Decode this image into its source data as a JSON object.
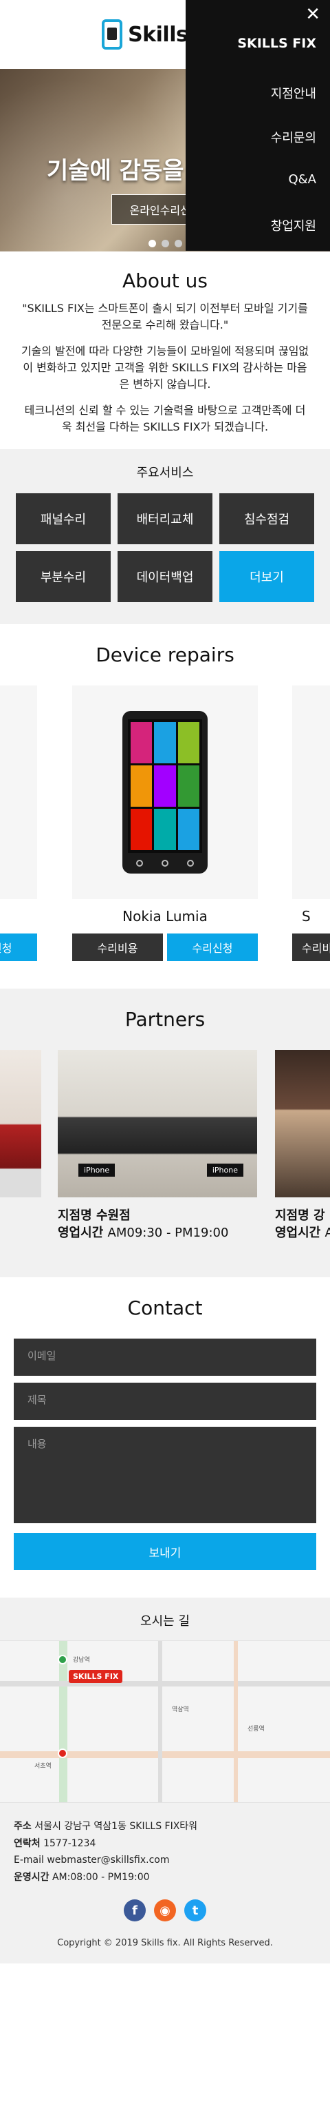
{
  "header": {
    "logo_text": "Skills Fix"
  },
  "hero": {
    "title": "기술에 감동을 더합니다.",
    "button_label": "온라인수리신청",
    "slide_count": 3,
    "active_slide": 1
  },
  "menu": {
    "close_label": "✕",
    "brand": "SKILLS FIX",
    "items": [
      "지점안내",
      "수리문의",
      "Q&A",
      "창업지원"
    ]
  },
  "about": {
    "title": "About us",
    "p1": "\"SKILLS FIX는 스마트폰이 출시 되기 이전부터 모바일 기기를 전문으로 수리해 왔습니다.\"",
    "p2": "기술의 발전에 따라 다양한 기능들이 모바일에 적용되며 끊임없이 변화하고 있지만 고객을 위한 SKILLS FIX의 감사하는 마음은 변하지 않습니다.",
    "p3": "테크니션의 신뢰 할 수 있는 기술력을 바탕으로 고객만족에 더욱 최선을 다하는 SKILLS FIX가 되겠습니다."
  },
  "services": {
    "title": "주요서비스",
    "items": [
      "패널수리",
      "배터리교체",
      "침수점검",
      "부분수리",
      "데이터백업",
      "더보기"
    ]
  },
  "devices": {
    "title": "Device repairs",
    "center_name": "Nokia Lumia",
    "cost_label": "수리비용",
    "request_label": "수리신청",
    "side_name_fragment": "S"
  },
  "partners": {
    "title": "Partners",
    "branch_label": "지점명",
    "hours_label": "영업시간",
    "center": {
      "name": "수원점",
      "hours": "AM09:30 - PM19:00"
    },
    "right": {
      "name": "강",
      "hours": "A"
    },
    "sign_text": "iPhone"
  },
  "contact": {
    "title": "Contact",
    "email_placeholder": "이메일",
    "subject_placeholder": "제목",
    "message_placeholder": "내용",
    "send_label": "보내기"
  },
  "footer": {
    "map_title": "오시는 길",
    "map_pin": "SKILLS FIX",
    "map_labels": [
      "강남역",
      "역삼역",
      "서초역",
      "선릉역"
    ],
    "address_label": "주소",
    "address": "서울시 강남구 역삼1동 SKILLS FIX타워",
    "phone_label": "연락처",
    "phone": "1577-1234",
    "email_label": "E-mail",
    "email": "webmaster@skillsfix.com",
    "hours_label": "운영시간",
    "hours": "AM:08:00 - PM19:00",
    "copyright": "Copyright © 2019 Skills fix. All Rights Reserved."
  },
  "colors": {
    "accent": "#0aa6e8",
    "dark": "#333333",
    "menu_bg": "#111111",
    "section_bg": "#f1f1f1"
  }
}
